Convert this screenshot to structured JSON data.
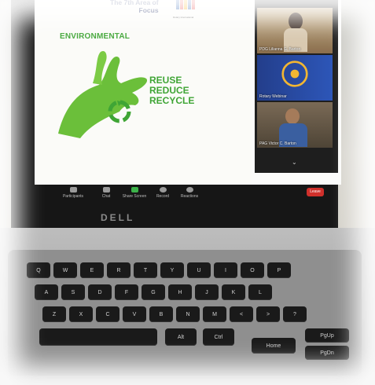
{
  "slide": {
    "heading_line1": "The 7th Area of",
    "heading_line2": "Focus",
    "logo_caption": "Rotary International",
    "env_title": "ENVIRONMENTAL",
    "rrr": [
      "REUSE",
      "REDUCE",
      "RECYCLE"
    ]
  },
  "gallery": {
    "participants": [
      {
        "name": "PDG Lilianna G. Barton"
      },
      {
        "name": "Rotary Webinar"
      },
      {
        "name": "PAG Victor C. Barton"
      }
    ]
  },
  "toolbar": {
    "participants": "Participants",
    "chat": "Chat",
    "share": "Share Screen",
    "record": "Record",
    "reactions": "Reactions",
    "leave": "Leave"
  },
  "laptop": {
    "brand": "DELL"
  },
  "keyboard": {
    "row1": [
      "Q",
      "W",
      "E",
      "R",
      "T",
      "Y",
      "U",
      "I",
      "O",
      "P"
    ],
    "row2": [
      "A",
      "S",
      "D",
      "F",
      "G",
      "H",
      "J",
      "K",
      "L"
    ],
    "row3": [
      "Z",
      "X",
      "C",
      "V",
      "B",
      "N",
      "M",
      "<",
      ">",
      "?"
    ],
    "row4": [
      "Alt",
      "Ctrl"
    ],
    "home_key": "Home",
    "pgup_key": "PgUp",
    "pgdn_key": "PgDn"
  }
}
